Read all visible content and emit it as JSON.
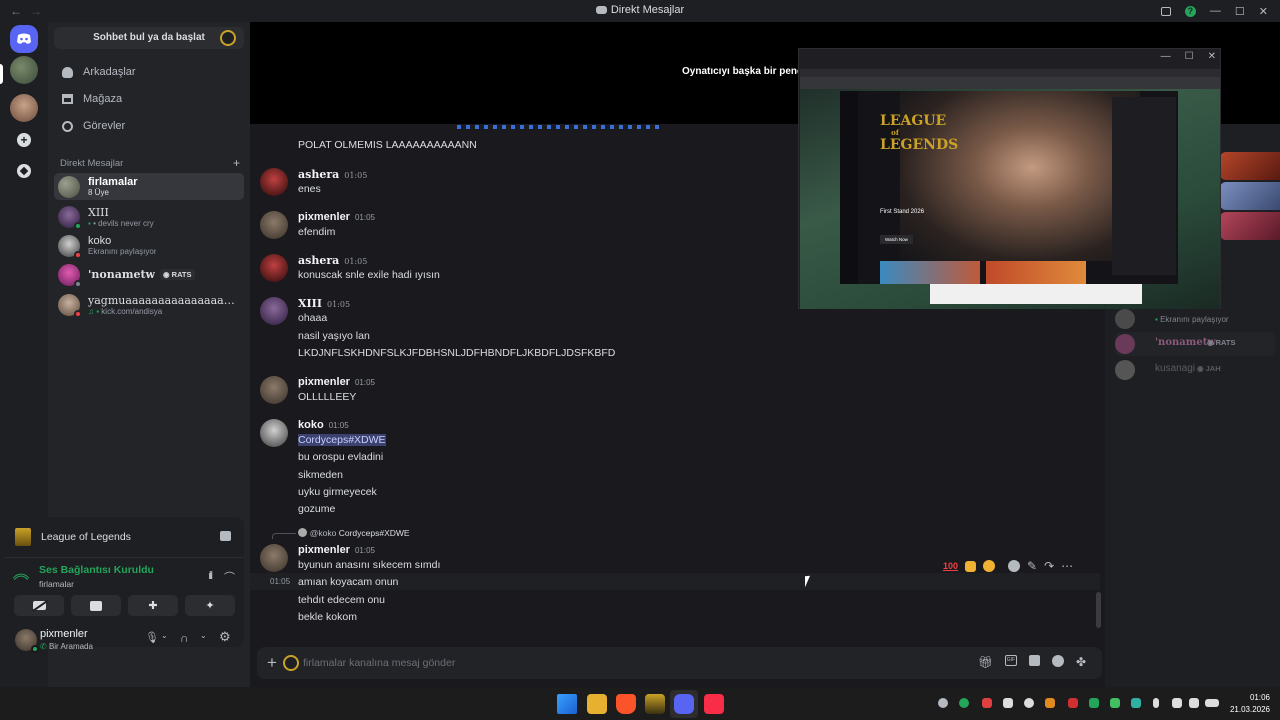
{
  "window": {
    "title": "Direkt Mesajlar"
  },
  "sidebar": {
    "search_placeholder": "Sohbet bul ya da başlat",
    "nav": [
      {
        "label": "Arkadaşlar"
      },
      {
        "label": "Mağaza"
      },
      {
        "label": "Görevler"
      }
    ],
    "dm_header": "Direkt Mesajlar",
    "dms": [
      {
        "name": "firlamalar",
        "sub": "8 Üye"
      },
      {
        "name": "XIII",
        "sub": "• devils never cry"
      },
      {
        "name": "koko",
        "sub": "Ekranını paylaşıyor"
      },
      {
        "name": "'nonametw",
        "tag": "RATS"
      },
      {
        "name": "yagmuaaaaaaaaaaaaaaaaaa...",
        "sub": "kick.com/andisya"
      }
    ]
  },
  "voice": {
    "activity": "League of Legends",
    "status": "Ses Bağlantısı Kuruldu",
    "channel": "firlamalar"
  },
  "user": {
    "name": "pixmenler",
    "status": "Bir Aramada"
  },
  "stream": {
    "message": "Oynatıcıyı başka bir penc"
  },
  "messages": [
    {
      "lines": [
        "POLAT OLMEMIS LAAAAAAAAAANN"
      ]
    },
    {
      "author": "ashera",
      "time": "01:05",
      "lines": [
        "enes"
      ]
    },
    {
      "author": "pixmenler",
      "time": "01:05",
      "lines": [
        "efendim"
      ]
    },
    {
      "author": "ashera",
      "time": "01:05",
      "lines": [
        "konuscak snle exile hadi ıyısın"
      ]
    },
    {
      "author": "XIII",
      "time": "01:05",
      "lines": [
        "ohaaa",
        "nasil yaşıyo lan",
        "LKDJNFLSKHDNFSLKJFDBHSNLJDFHBNDFLJKBDFLJDSFKBFD"
      ]
    },
    {
      "author": "pixmenler",
      "time": "01:05",
      "lines": [
        "OLLLLLEEY"
      ]
    },
    {
      "author": "koko",
      "time": "01:05",
      "mention": "Cordyceps#XDWE",
      "lines": [
        "bu orospu evladini",
        "sikmeden",
        "uyku girmeyecek",
        "gozume"
      ]
    },
    {
      "reply_to": "@koko",
      "reply_text": "Cordyceps#XDWE",
      "author": "pixmenler",
      "time": "01:05",
      "hover_time": "01:05",
      "lines": [
        "byunun anasını sıkecem sımdı",
        "amıan koyacam onun",
        "tehdıt edecem onu",
        "bekle kokom"
      ]
    }
  ],
  "composer": {
    "placeholder": "firlamalar kanalına mesaj gönder"
  },
  "members": {
    "items": [
      {
        "sub": "Ekranını paylaşıyor"
      },
      {
        "name": "'nonametw",
        "tag": "RATS"
      },
      {
        "name": "kusanagi",
        "tag": "JAH"
      }
    ]
  },
  "popup": {
    "league_title_1": "LEAGUE",
    "league_title_2": "of",
    "league_title_3": "LEGENDS",
    "event_title": "First Stand 2026",
    "event_button": "Watch Now"
  },
  "clock": {
    "time": "01:06",
    "date": "21.03.2026"
  },
  "colors": {
    "accent": "#5865f2",
    "online": "#23a55a",
    "dnd": "#f23f43",
    "voice_green": "#23a55a"
  }
}
